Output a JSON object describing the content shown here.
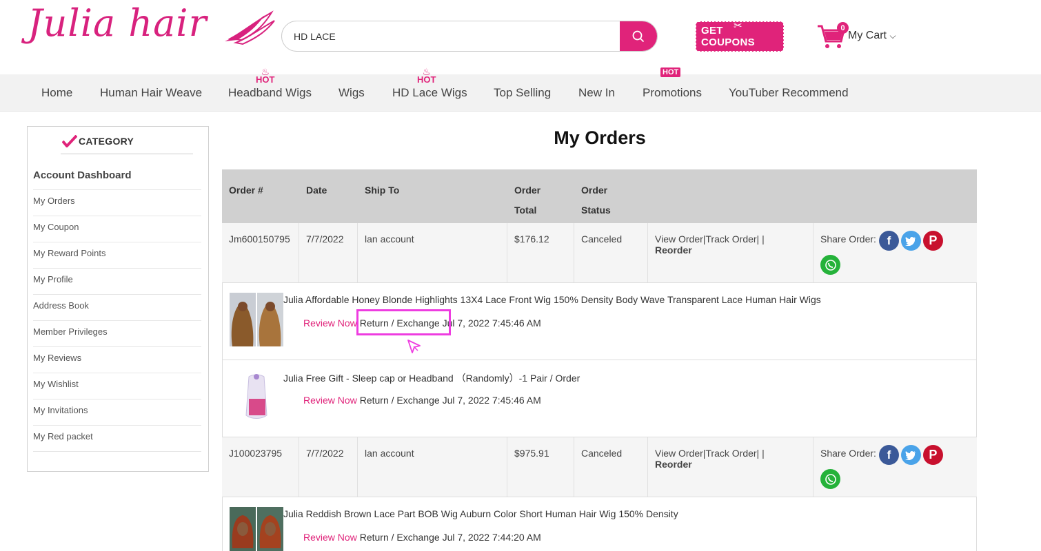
{
  "header": {
    "logo_text": "Julia hair",
    "search_value": "HD LACE",
    "coupons_label": "GET COUPONS",
    "cart_count": "0",
    "cart_label": "My Cart"
  },
  "nav": {
    "items": [
      "Home",
      "Human Hair Weave",
      "Headband Wigs",
      "Wigs",
      "HD Lace Wigs",
      "Top Selling",
      "New In",
      "Promotions",
      "YouTuber Recommend"
    ],
    "hot_label": "HOT"
  },
  "sidebar": {
    "title": "CATEGORY",
    "items": [
      "Account Dashboard",
      "My Orders",
      "My Coupon",
      "My Reward Points",
      "My Profile",
      "Address Book",
      "Member Privileges",
      "My Reviews",
      "My Wishlist",
      "My Invitations",
      "My Red packet"
    ]
  },
  "main": {
    "title": "My Orders",
    "columns": {
      "order_num": "Order #",
      "date": "Date",
      "ship_to": "Ship To",
      "order_total_1": "Order",
      "order_total_2": "Total",
      "order_status_1": "Order",
      "order_status_2": "Status"
    },
    "actions": {
      "view_track": "View Order|Track Order| |",
      "reorder": "Reorder",
      "share": "Share Order:",
      "review": "Review Now",
      "return": "Return / Exchange"
    },
    "orders": [
      {
        "id": "Jm600150795",
        "date": "7/7/2022",
        "ship_to": "lan account",
        "total": "$176.12",
        "status": "Canceled",
        "items": [
          {
            "title": "Julia Affordable Honey Blonde Highlights 13X4 Lace Front Wig 150% Density Body Wave Transparent Lace Human Hair Wigs",
            "time": "Jul 7, 2022 7:45:46 AM"
          },
          {
            "title": "Julia Free Gift - Sleep cap or Headband （Randomly）-1 Pair / Order",
            "time": "Jul 7, 2022 7:45:46 AM"
          }
        ]
      },
      {
        "id": "J100023795",
        "date": "7/7/2022",
        "ship_to": "lan account",
        "total": "$975.91",
        "status": "Canceled",
        "items": [
          {
            "title": "Julia Reddish Brown Lace Part BOB Wig Auburn Color Short Human Hair Wig 150% Density",
            "time": "Jul 7, 2022 7:44:20 AM"
          }
        ]
      }
    ]
  },
  "colors": {
    "brand": "#e0237a",
    "highlight": "#ee3ce0"
  }
}
